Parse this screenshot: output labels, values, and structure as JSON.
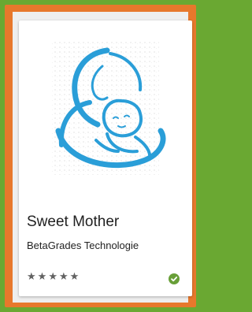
{
  "app_card": {
    "title": "Sweet Mother",
    "developer": "BetaGrades Technologie",
    "rating": {
      "value": 5,
      "max": 5,
      "star_glyph": "★"
    },
    "icon": "mother-and-baby-icon",
    "installed_icon": "checkmark-circle-icon"
  },
  "colors": {
    "outer_border": "#6aa832",
    "frame": "#e7782c",
    "icon_blue": "#2a9ed8",
    "star": "#616161",
    "installed_badge": "#689f38"
  }
}
